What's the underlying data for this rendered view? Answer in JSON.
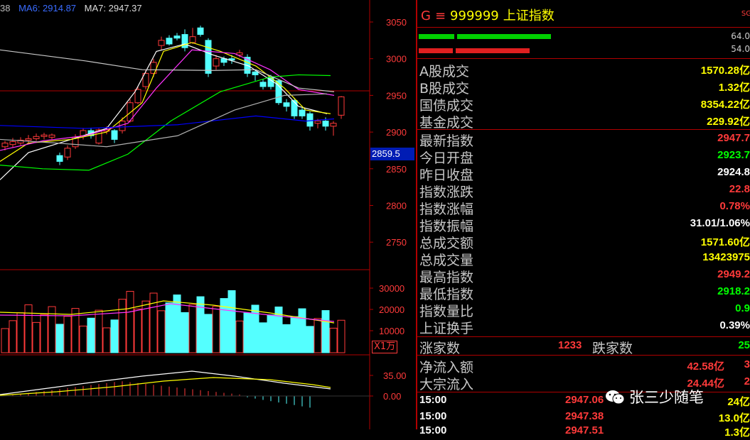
{
  "ma_legend": [
    {
      "label": "38",
      "color": "#bbbbbb"
    },
    {
      "label": "MA6: 2914.87",
      "color": "#3a6cff"
    },
    {
      "label": "MA7: 2947.37",
      "color": "#dddddd"
    }
  ],
  "price_axis": [
    "3050",
    "3000",
    "2950",
    "2900",
    "2850",
    "2800",
    "2750"
  ],
  "price_highlight": "2859.5",
  "volume_axis": [
    "30000",
    "20000",
    "10000"
  ],
  "volume_unit": "X1万",
  "indicator_axis": [
    "35.00",
    "0.00"
  ],
  "colors": {
    "up": "#ff3a3a",
    "down": "#54ffff",
    "grid": "#b00000",
    "ma1": "#ffffff",
    "ma2": "#ffff00",
    "ma3": "#ff33ff",
    "ma4": "#00ff00",
    "ma5": "#0000ff",
    "ma6": "#c8c8c8"
  },
  "header": {
    "g": "G",
    "eq": "≡",
    "code": "999999",
    "name": "上证指数",
    "tag": "SG"
  },
  "ratios": [
    "64.0",
    "54.0"
  ],
  "stats": [
    {
      "label": "A股成交",
      "value": "1570.28亿",
      "color": "#ffff00"
    },
    {
      "label": "B股成交",
      "value": "1.32亿",
      "color": "#ffff00"
    },
    {
      "label": "国债成交",
      "value": "8354.22亿",
      "color": "#ffff00"
    },
    {
      "label": "基金成交",
      "value": "229.92亿",
      "color": "#ffff00"
    },
    {
      "label": "最新指数",
      "value": "2947.7",
      "color": "#ff3a3a"
    },
    {
      "label": "今日开盘",
      "value": "2923.7",
      "color": "#00ff00"
    },
    {
      "label": "昨日收盘",
      "value": "2924.8",
      "color": "#ffffff"
    },
    {
      "label": "指数涨跌",
      "value": "22.8",
      "color": "#ff3a3a"
    },
    {
      "label": "指数涨幅",
      "value": "0.78%",
      "color": "#ff3a3a"
    },
    {
      "label": "指数振幅",
      "value": "31.01/1.06%",
      "color": "#ffffff"
    },
    {
      "label": "总成交额",
      "value": "1571.60亿",
      "color": "#ffff00"
    },
    {
      "label": "总成交量",
      "value": "13423975",
      "color": "#ffff00"
    },
    {
      "label": "最高指数",
      "value": "2949.2",
      "color": "#ff3a3a"
    },
    {
      "label": "最低指数",
      "value": "2918.2",
      "color": "#00ff00"
    },
    {
      "label": "指数量比",
      "value": "0.9",
      "color": "#00ff00"
    },
    {
      "label": "上证换手",
      "value": "0.39%",
      "color": "#ffffff"
    }
  ],
  "rise_fall": {
    "rise_label": "涨家数",
    "rise": "1233",
    "fall_label": "跌家数",
    "fall": "25"
  },
  "flows": [
    {
      "label": "净流入额",
      "value": "42.58亿",
      "extra": "3"
    },
    {
      "label": "大宗流入",
      "value": "24.44亿",
      "extra": "2"
    }
  ],
  "ticks": [
    {
      "time": "15:00",
      "price": "2947.06",
      "vol": "24亿"
    },
    {
      "time": "15:00",
      "price": "2947.38",
      "vol": "13.0亿"
    },
    {
      "time": "15:00",
      "price": "2947.51",
      "vol": "1.3亿"
    }
  ],
  "watermark": "张三少随笔"
}
